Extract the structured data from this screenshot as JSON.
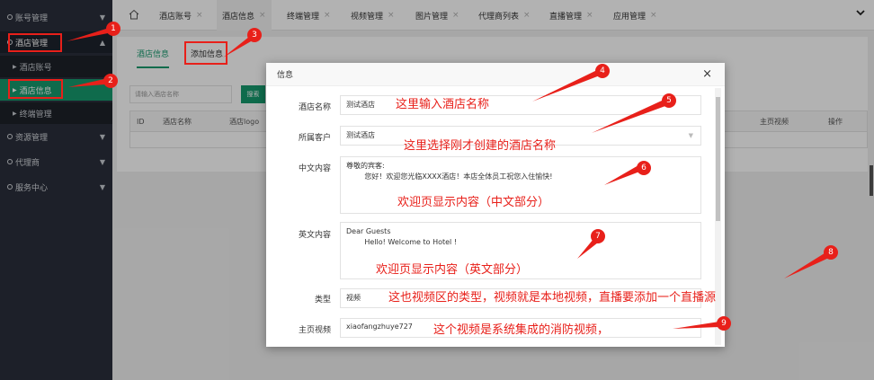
{
  "sidebar": {
    "items": [
      {
        "label": "账号管理",
        "caret": "▼"
      },
      {
        "label": "酒店管理",
        "caret": "▲"
      },
      {
        "label": "资源管理",
        "caret": "▼"
      },
      {
        "label": "代理商",
        "caret": "▼"
      },
      {
        "label": "服务中心",
        "caret": "▼"
      }
    ],
    "sub_items": [
      {
        "label": "酒店账号"
      },
      {
        "label": "酒店信息"
      },
      {
        "label": "终端管理"
      }
    ]
  },
  "tabs": [
    {
      "label": "酒店账号"
    },
    {
      "label": "酒店信息"
    },
    {
      "label": "终端管理"
    },
    {
      "label": "视频管理"
    },
    {
      "label": "图片管理"
    },
    {
      "label": "代理商列表"
    },
    {
      "label": "直播管理"
    },
    {
      "label": "应用管理"
    }
  ],
  "main": {
    "subtabs": [
      "酒店信息",
      "添加信息"
    ],
    "search_placeholder": "请输入酒店名称",
    "search_button": "搜索",
    "columns": [
      "ID",
      "酒店名称",
      "酒店logo",
      "主页视频",
      "操作"
    ]
  },
  "modal": {
    "title": "信息",
    "close": "×",
    "fields": {
      "hotel_name": {
        "label": "酒店名称",
        "value": "测试酒店"
      },
      "customer": {
        "label": "所属客户",
        "value": "测试酒店"
      },
      "cn_content": {
        "label": "中文内容",
        "value": "尊敬的宾客:\n        您好！欢迎您光临XXXX酒店！本店全体员工祝您入住愉快!"
      },
      "en_content": {
        "label": "英文内容",
        "value": "Dear Guests\n        Hello! Welcome to Hotel !"
      },
      "type": {
        "label": "类型",
        "value": "视频"
      },
      "home_video": {
        "label": "主页视频",
        "value": "xiaofangzhuye727"
      }
    }
  },
  "annotations": {
    "a4": "这里输入酒店名称",
    "a5": "这里选择刚才创建的酒店名称",
    "a6": "欢迎页显示内容（中文部分）",
    "a7": "欢迎页显示内容（英文部分）",
    "a8": "这也视频区的类型，视频就是本地视频，直播要添加一个直播源",
    "a9": "这个视频是系统集成的消防视频，",
    "badges": [
      "1",
      "2",
      "3",
      "4",
      "5",
      "6",
      "7",
      "8",
      "9"
    ]
  },
  "colors": {
    "sidebar_bg": "#2a2f3b",
    "accent": "#169a6e",
    "annotation": "#e8201a"
  }
}
